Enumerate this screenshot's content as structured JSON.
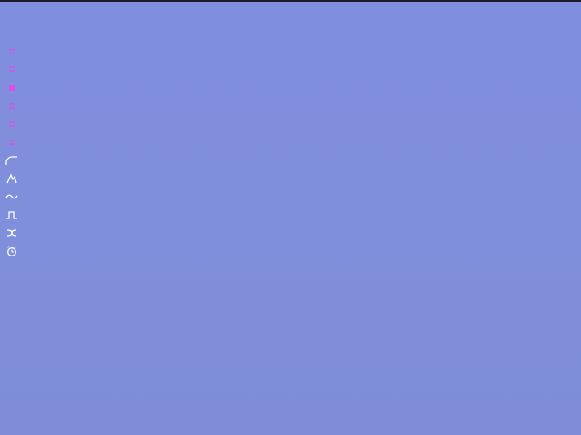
{
  "colors": {
    "background": "#808fdd",
    "top_bar": "#1c1c28",
    "magenta_tool": "#e04be8",
    "white_tool": "#ffffff"
  },
  "toolbar": {
    "items": [
      {
        "icon": "menu-lines-icon",
        "color": "magenta"
      },
      {
        "icon": "menu-lines-icon",
        "color": "magenta"
      },
      {
        "icon": "menu-lines-icon",
        "color": "magenta",
        "selected": true
      },
      {
        "icon": "menu-lines-icon",
        "color": "magenta"
      },
      {
        "icon": "menu-lines-icon",
        "color": "magenta"
      },
      {
        "icon": "menu-lines-icon",
        "color": "magenta"
      },
      {
        "icon": "ramp-wave-icon",
        "color": "white"
      },
      {
        "icon": "spike-wave-icon",
        "color": "white"
      },
      {
        "icon": "sine-wave-icon",
        "color": "white"
      },
      {
        "icon": "square-wave-icon",
        "color": "white"
      },
      {
        "icon": "shuffle-icon",
        "color": "white"
      },
      {
        "icon": "alarm-clock-icon",
        "color": "white"
      }
    ]
  }
}
